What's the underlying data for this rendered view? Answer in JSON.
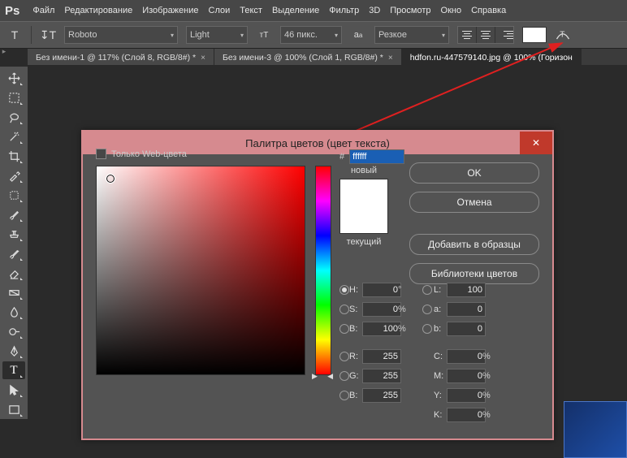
{
  "menu": [
    "Файл",
    "Редактирование",
    "Изображение",
    "Слои",
    "Текст",
    "Выделение",
    "Фильтр",
    "3D",
    "Просмотр",
    "Окно",
    "Справка"
  ],
  "toolbar": {
    "font_family": "Roboto",
    "font_style": "Light",
    "font_size": "46 пикс.",
    "antialias": "Резкое",
    "color_swatch": "#ffffff"
  },
  "tabs": [
    {
      "label": "Без имени-1 @ 117% (Слой 8, RGB/8#) *",
      "active": false
    },
    {
      "label": "Без имени-3 @ 100% (Слой 1, RGB/8#) *",
      "active": false
    },
    {
      "label": "hdfon.ru-447579140.jpg @ 100% (Горизон",
      "active": true
    }
  ],
  "dialog": {
    "title": "Палитра цветов (цвет текста)",
    "ok": "OK",
    "cancel": "Отмена",
    "add_swatch": "Добавить в образцы",
    "libraries": "Библиотеки цветов",
    "new_label": "новый",
    "current_label": "текущий",
    "web_only": "Только Web-цвета",
    "hex_prefix": "#",
    "hex_value": "ffffff",
    "hsb": {
      "h": "0",
      "s": "0",
      "b": "100"
    },
    "lab": {
      "l": "100",
      "a": "0",
      "b": "0"
    },
    "rgb": {
      "r": "255",
      "g": "255",
      "b": "255"
    },
    "cmyk": {
      "c": "0",
      "m": "0",
      "y": "0",
      "k": "0"
    },
    "deg": "°",
    "pct": "%"
  }
}
